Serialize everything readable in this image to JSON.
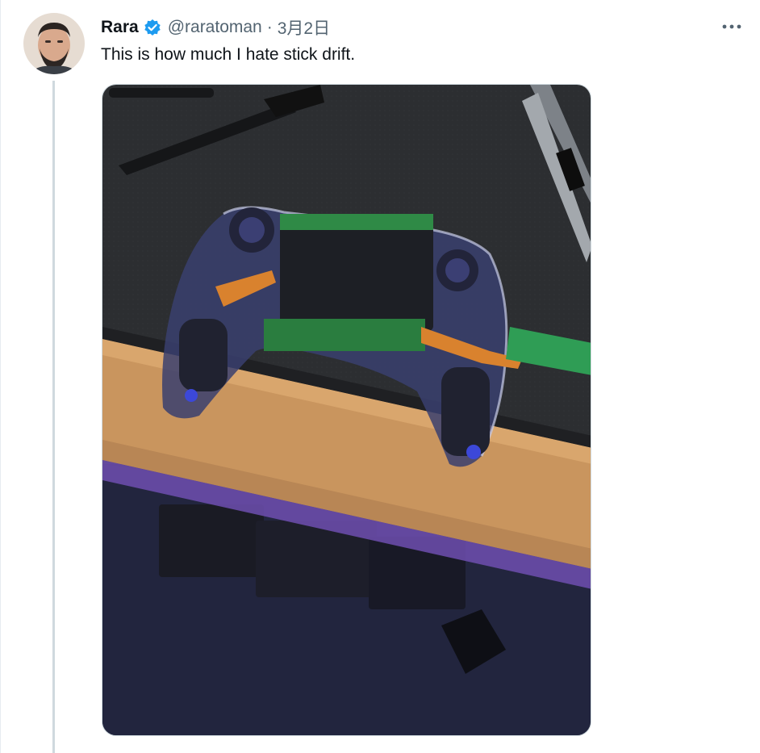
{
  "author": {
    "name": "Rara",
    "handle": "@raratoman",
    "separator": "·",
    "date": "3月2日",
    "verified": true
  },
  "tweet": {
    "text": "This is how much I hate stick drift."
  },
  "icons": {
    "verified": "verified-badge-icon",
    "more": "more-options-icon"
  },
  "colors": {
    "accent": "#1d9bf0",
    "text": "#0f1419",
    "muted": "#536471",
    "border": "#cfd9de"
  }
}
